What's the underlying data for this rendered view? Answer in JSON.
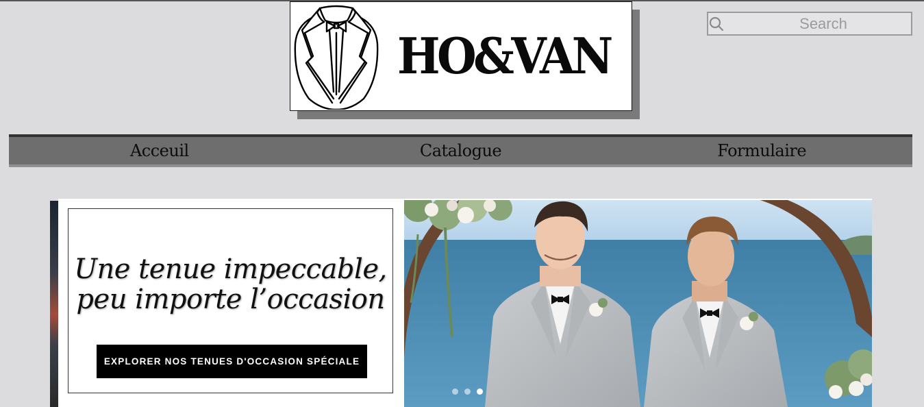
{
  "brand": {
    "logo_text": "HO&VAN"
  },
  "search": {
    "placeholder": "Search"
  },
  "nav": {
    "items": [
      {
        "label": "Acceuil"
      },
      {
        "label": "Catalogue"
      },
      {
        "label": "Formulaire"
      }
    ]
  },
  "hero": {
    "headline_line1": "Une tenue impeccable,",
    "headline_line2": "peu importe l’occasion",
    "cta_label": "EXPLORER NOS TENUES D'OCCASION SPÉCIALE",
    "carousel": {
      "slide_count": 3,
      "active_index": 2
    }
  },
  "icons": {
    "search": "search-icon",
    "logo": "tuxedo-logo-icon"
  },
  "colors": {
    "page_background": "#dcdcde",
    "nav_background": "#6e6e6e",
    "logo_shadow": "#7a7a7a",
    "cta_background": "#000000",
    "suit_grey": "#b9bcbf",
    "sea_blue": "#3f7fa6"
  }
}
